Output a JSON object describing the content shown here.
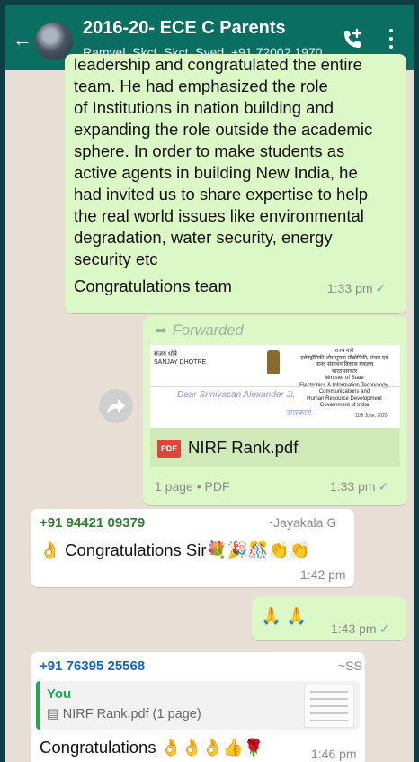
{
  "header": {
    "title": "2016-20- ECE C Parents",
    "subtitle": "Ramvel, Skct, Skct, Syed, +91 72002 1970..."
  },
  "messages": [
    {
      "type": "outgoing",
      "text": "leadership and congratulated the entire\nteam. He had emphasized the role\nof Institutions in nation building and\nexpanding the role outside the academic\nsphere. In order to make students as\nactive agents in building New India, he\nhad invited us to share expertise to help\nthe real world issues like environmental\ndegradation, water security, energy\nsecurity etc",
      "tail": "Congratulations team",
      "time": "1:33 pm"
    },
    {
      "type": "outgoing-forwarded",
      "forwarded_label": "Forwarded",
      "preview": {
        "left_lines": [
          "संजय धोत्रे",
          "SANJAY DHOTRE"
        ],
        "right_lines": [
          "राज्य मंत्री",
          "इलेक्ट्रॉनिकी और सूचना प्रौद्योगिकी, संचार एवं",
          "मानव संसाधन विकास मंत्रालय",
          "भारत सरकार",
          "Minister of State",
          "Electronics & Information Technology,",
          "Communications and",
          "Human Resource Development",
          "Government of India"
        ],
        "handwriting": "Dear  Srinivasan  Alexander  Ji,",
        "handwriting2": "नमस्कार!",
        "date": "11th June, 2020"
      },
      "file_name": "NIRF Rank.pdf",
      "file_meta": "1 page • PDF",
      "time": "1:33 pm"
    },
    {
      "type": "incoming",
      "sender": "+91 94421 09379",
      "alias": "~Jayakala G",
      "text": "👌 Congratulations Sir💐🎉🎊👏👏",
      "time": "1:42 pm"
    },
    {
      "type": "outgoing",
      "text": "🙏 🙏",
      "time": "1:43 pm"
    },
    {
      "type": "incoming",
      "sender": "+91 76395 25568",
      "alias": "~SS",
      "quote_author": "You",
      "quote_file": "NIRF Rank.pdf (1 page)",
      "text": "Congratulations 👌👌👌👍🌹",
      "time": "1:46 pm"
    }
  ],
  "colors": {
    "header": "#0b6e62",
    "outgoing_bubble": "#dcf8c6",
    "incoming_bubble": "#ffffff",
    "sender1": "#2e7d32",
    "sender2": "#1565c0"
  },
  "icons": [
    "back-arrow-icon",
    "add-call-icon",
    "more-vert-icon",
    "forward-icon",
    "pdf-icon",
    "read-tick-icon",
    "document-icon"
  ]
}
